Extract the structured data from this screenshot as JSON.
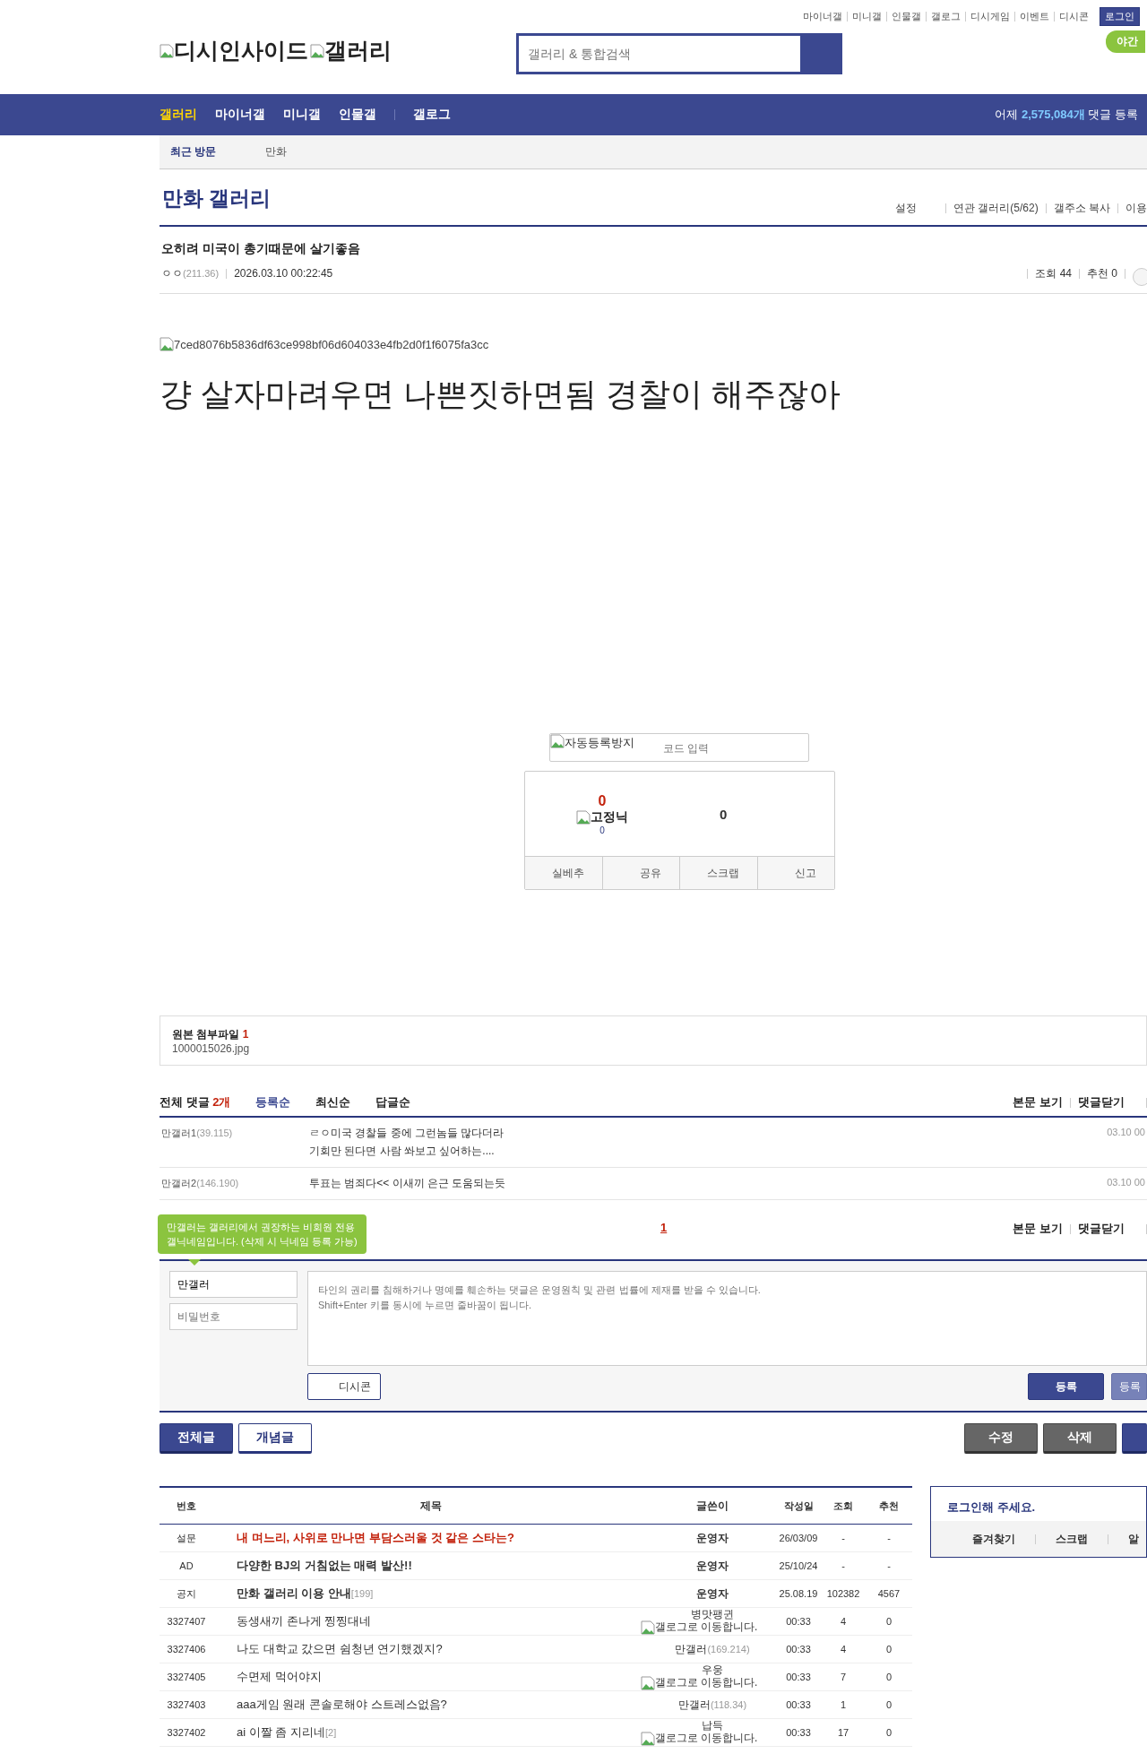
{
  "top_links": [
    "마이너갤",
    "미니갤",
    "인물갤",
    "갤로그",
    "디시게임",
    "이벤트",
    "디시콘"
  ],
  "login_button": "로그인",
  "night_mode": "야간",
  "logo": {
    "site_alt": "디시인사이드",
    "gallery_alt": "갤러리"
  },
  "search": {
    "placeholder": "갤러리 & 통합검색"
  },
  "nav": {
    "items": [
      {
        "label": "갤러리",
        "selected": true
      },
      {
        "label": "마이너갤",
        "selected": false
      },
      {
        "label": "미니갤",
        "selected": false
      },
      {
        "label": "인물갤",
        "selected": false
      },
      {
        "label": "갤로그",
        "selected": false
      }
    ],
    "yesterday": {
      "prefix": "어제",
      "count": "2,575,084개",
      "suffix": "댓글 등록"
    }
  },
  "recent": {
    "label": "최근 방문",
    "items": [
      "만화"
    ]
  },
  "gallery": {
    "title": "만화 갤러리",
    "links": [
      "설정",
      "연관 갤러리(5/62)",
      "갤주소 복사",
      "이용"
    ]
  },
  "post": {
    "title": "오히려 미국이 총기때문에 살기좋음",
    "author": "ㅇㅇ",
    "ip": "(211.36)",
    "date": "2026.03.10 00:22:45",
    "views": "조회 44",
    "recommends": "추천 0",
    "image_alt": "7ced8076b5836df63ce998bf06d604033e4fb2d0f1f6075fa3cc",
    "body": "걍 살자마려우면 나쁜짓하면됨 경찰이 해주잖아"
  },
  "captcha": {
    "image_alt": "자동등록방지",
    "placeholder": "코드 입력"
  },
  "vote": {
    "up_count": "0",
    "fixed_alt": "고정닉",
    "fixed_count": "0",
    "down_count": "0",
    "buttons": [
      "실베추",
      "공유",
      "스크랩",
      "신고"
    ]
  },
  "attachment": {
    "label": "원본 첨부파일",
    "count": "1",
    "file": "1000015026.jpg"
  },
  "comments": {
    "label": "전체 댓글",
    "count": "2개",
    "sorts": [
      {
        "label": "등록순",
        "selected": true
      },
      {
        "label": "최신순",
        "selected": false
      },
      {
        "label": "답글순",
        "selected": false
      }
    ],
    "actions": [
      "본문 보기",
      "댓글닫기"
    ],
    "items": [
      {
        "name": "만갤러1",
        "ip": "(39.115)",
        "lines": [
          "ㄹㅇ미국 경찰들 중에 그런놈들 많다더라",
          "기회만 된다면 사람 쏴보고 싶어하는...."
        ],
        "date": "03.10 00"
      },
      {
        "name": "만갤러2",
        "ip": "(146.190)",
        "lines": [
          "투표는 범죄다<< 이새끼 은근 도움되는듯"
        ],
        "date": "03.10 00"
      }
    ]
  },
  "paging": {
    "pages": [
      {
        "label": "1",
        "selected": true
      }
    ],
    "actions": [
      "본문 보기",
      "댓글닫기"
    ]
  },
  "comment_form": {
    "tooltip": [
      "만갤러는 갤러리에서 권장하는 비회원 전용",
      "갤닉네임입니다. (삭제 시 닉네임 등록 가능)"
    ],
    "name_value": "만갤러",
    "password_placeholder": "비밀번호",
    "text_placeholder": "타인의 권리를 침해하거나 명예를 훼손하는 댓글은 운영원칙 및 관련 법률에 제재를 받을 수 있습니다.\nShift+Enter 키를 동시에 누르면 줄바꿈이 됩니다.",
    "dccon": "디시콘",
    "submit": "등록",
    "submit_alt": "등록"
  },
  "left_buttons": [
    {
      "label": "전체글",
      "kind": "primary"
    },
    {
      "label": "개념글",
      "kind": "outline"
    }
  ],
  "right_buttons": [
    {
      "label": "수정",
      "kind": "gray"
    },
    {
      "label": "삭제",
      "kind": "gray"
    },
    {
      "kind": "primary"
    }
  ],
  "list": {
    "columns": [
      "번호",
      "제목",
      "글쓴이",
      "작성일",
      "조회",
      "추천"
    ],
    "rows": [
      {
        "kind": "survey",
        "no": "설문",
        "subject": "내 며느리, 사위로 만나면 부담스러울 것 같은 스타는?",
        "author": "운영자",
        "date": "26/03/09",
        "views": "-",
        "recs": "-"
      },
      {
        "kind": "ad",
        "no": "AD",
        "subject": "다양한 BJ의 거침없는 매력 발산!!",
        "author": "운영자",
        "date": "25/10/24",
        "views": "-",
        "recs": "-"
      },
      {
        "kind": "notice",
        "no": "공지",
        "subject": "만화 갤러리 이용 안내",
        "replies": "[199]",
        "author": "운영자",
        "date": "25.08.19",
        "views": "102382",
        "recs": "4567"
      },
      {
        "kind": "post",
        "no": "3327407",
        "subject": "동생새끼 존나게 찡찡대네",
        "author": "병맛팽귄",
        "gallog_alt": "갤로그로 이동합니다.",
        "date": "00:33",
        "views": "4",
        "recs": "0"
      },
      {
        "kind": "post",
        "no": "3327406",
        "subject": "나도 대학교 갔으면 쉼청년 연기했겠지?",
        "author": "만갤러",
        "ip": "(169.214)",
        "date": "00:33",
        "views": "4",
        "recs": "0"
      },
      {
        "kind": "post",
        "no": "3327405",
        "subject": "수면제 먹어야지",
        "author": "우웅",
        "gallog_alt": "갤로그로 이동합니다.",
        "date": "00:33",
        "views": "7",
        "recs": "0"
      },
      {
        "kind": "post",
        "no": "3327403",
        "subject": "aaa게임 원래 콘솔로해야 스트레스없음?",
        "author": "만갤러",
        "ip": "(118.34)",
        "date": "00:33",
        "views": "1",
        "recs": "0"
      },
      {
        "kind": "post",
        "no": "3327402",
        "subject": "ai 이짤 좀 지리네",
        "replies": "[2]",
        "author": "납득",
        "gallog_alt": "갤로그로 이동합니다.",
        "date": "00:33",
        "views": "17",
        "recs": "0"
      }
    ]
  },
  "login_box": {
    "title": "로그인해 주세요.",
    "links": [
      "즐겨찾기",
      "스크랩",
      "알"
    ]
  }
}
